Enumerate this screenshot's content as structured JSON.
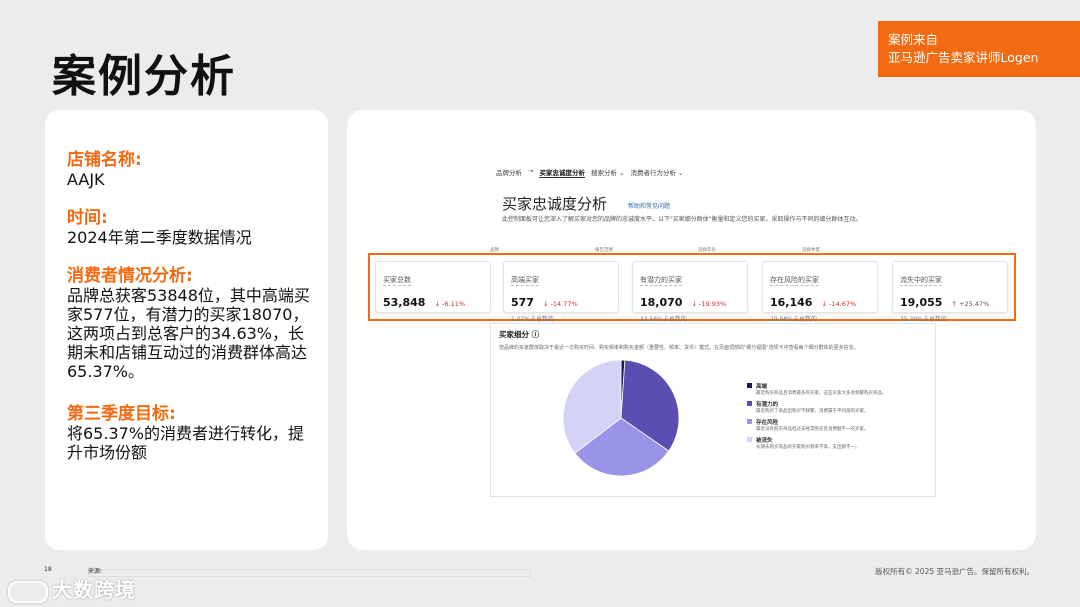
{
  "page": {
    "title": "案例分析",
    "source_tag": [
      "案例来自",
      "亚马逊广告卖家讲师Logen"
    ]
  },
  "case": {
    "sections": [
      {
        "label": "店铺名称:",
        "body": "AAJK"
      },
      {
        "label": "时间:",
        "body": "2024年第二季度数据情况"
      },
      {
        "label": "消费者情况分析:",
        "body": "品牌总获客53848位，其中高端买家577位，有潜力的买家18070，这两项占到总客户的34.63%，长期未和店铺互动过的消费群体高达65.37%。"
      },
      {
        "label": "第三季度目标:",
        "body": "将65.37%的消费者进行转化，提升市场份额"
      }
    ]
  },
  "dashboard": {
    "breadcrumb": [
      "品牌分析",
      "→",
      "买家忠诚度分析",
      "搜索分析 ⌄",
      "消费者行为分析 ⌄"
    ],
    "title": "买家忠诚度分析",
    "help_link": "帮助和常见问题",
    "description": "此控制面板可让您深入了解买家对您的品牌的忠诚度水平。以下\"买家细分群体\"衡量和定义您的买家。采取操作与不同的细分群体互动。",
    "column_labels": [
      "品牌",
      "报告范围",
      "选择年份",
      "选择季度"
    ],
    "metrics": [
      {
        "label": "买家总数",
        "value": "53,848",
        "change": "↓ -6.11%",
        "direction": "down",
        "pct": ""
      },
      {
        "label": "高端买家",
        "value": "577",
        "change": "↓ -14.77%",
        "direction": "down",
        "pct": "1.07%占总数的"
      },
      {
        "label": "有潜力的买家",
        "value": "18,070",
        "change": "↓ -19.93%",
        "direction": "down",
        "pct": "33.56%占总数的"
      },
      {
        "label": "存在风险的买家",
        "value": "16,146",
        "change": "↓ -14.67%",
        "direction": "down",
        "pct": "29.98%占总数的"
      },
      {
        "label": "流失中的买家",
        "value": "19,055",
        "change": "↑ +25.47%",
        "direction": "up",
        "pct": "35.39%占总数的"
      }
    ],
    "segment": {
      "title": "买家细分 ⓘ",
      "description": "您品牌的买家群体取决于最近一次购买时间、购买频率和购买金额（重要性、频率、货币）模式。在页面顶部的\"细分视图\"选项卡中查看每个细分群体的更多信息。",
      "legend": [
        {
          "name": "高端",
          "desc": "最近购买商品且消费最多的买家。这些买家大多会频繁购买商品。",
          "color": "#1e1650"
        },
        {
          "name": "有潜力的",
          "desc": "最近购买了商品但购买不频繁，消费属于平均值的买家。",
          "color": "#5a4fb0"
        },
        {
          "name": "存在风险",
          "desc": "最近没有购买商品但过去经常购买且消费额不一的买家。",
          "color": "#9a94e8"
        },
        {
          "name": "被流失",
          "desc": "长期未购买商品的买家购买频率不高，支出额不一。",
          "color": "#d4d2f5"
        }
      ]
    }
  },
  "footer": {
    "page_number": "18",
    "source_label": "来源:",
    "watermark": "大数跨境",
    "copyright": "版权所有© 2025 亚马逊广告。保留所有权利。"
  },
  "chart_data": {
    "type": "pie",
    "categories": [
      "高端",
      "有潜力的",
      "存在风险",
      "被流失"
    ],
    "values": [
      1.07,
      33.56,
      29.98,
      35.39
    ],
    "colors": [
      "#1e1650",
      "#5a4fb0",
      "#9a94e8",
      "#d4d2f5"
    ],
    "title": ""
  }
}
